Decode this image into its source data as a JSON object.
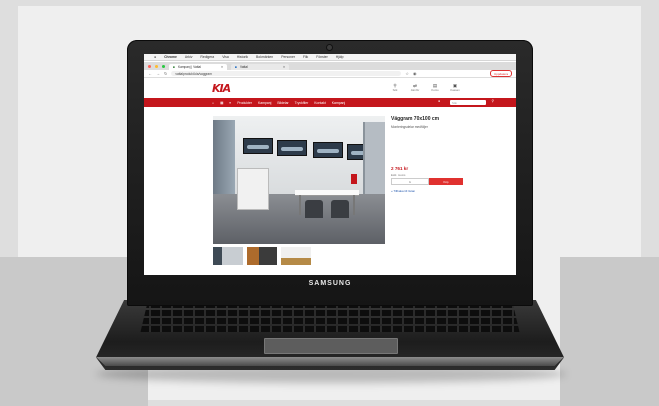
{
  "device": {
    "brand": "SAMSUNG"
  },
  "browser": {
    "menu": [
      "Chrome",
      "Arkiv",
      "Redigera",
      "Visa",
      "Historik",
      "Bokmärken",
      "Personer",
      "Flik",
      "Fönster",
      "Hjälp"
    ],
    "tabs": [
      {
        "label": "Kampanj | Vattal"
      },
      {
        "label": "Vattal"
      }
    ],
    "url": "vattalprodukt.kia/vaggram",
    "update_label": "Uppdatera"
  },
  "site": {
    "logo": "KIA",
    "utilities": [
      {
        "label": "Sök",
        "icon": "search-icon"
      },
      {
        "label": "Jämför",
        "icon": "compare-icon"
      },
      {
        "label": "Konto",
        "icon": "user-icon"
      },
      {
        "label": "Kassan",
        "icon": "cart-icon"
      }
    ],
    "nav": [
      "Produkter",
      "Kampanj",
      "Bildelar",
      "Tryckfiler",
      "Kontakt",
      "Kampanj"
    ],
    "search_placeholder": "Sök"
  },
  "product": {
    "title": "Väggram 70x100 cm",
    "subtitle": "Monteringsdelar medföljer",
    "price": "2 761 kr",
    "vat_note": "Exkl. moms",
    "qty": "1",
    "button": "Köp",
    "back_link": "« Tillbaka till listan"
  },
  "colors": {
    "brand_red": "#c4161c"
  }
}
